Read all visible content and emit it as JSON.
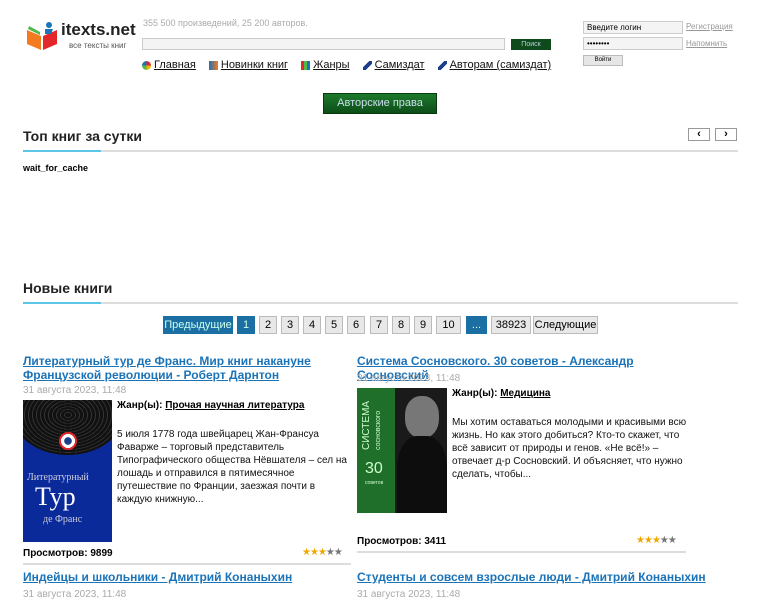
{
  "header": {
    "logo_text": "itexts.net",
    "logo_sub": "все тексты книг",
    "stats": "355 500 произведений, 25 200 авторов.",
    "search_button": "Поиск",
    "search_value": ""
  },
  "login": {
    "login_value": "Введите логин",
    "password_value": "••••••••",
    "register": "Регистрация",
    "remind": "Напомнить",
    "submit": "Войти"
  },
  "nav": [
    {
      "label": "Главная",
      "icon": "home-icon"
    },
    {
      "label": "Новинки книг",
      "icon": "new-books-icon"
    },
    {
      "label": "Жанры",
      "icon": "genres-icon"
    },
    {
      "label": "Самиздат",
      "icon": "pen-icon"
    },
    {
      "label": "Авторам (самиздат)",
      "icon": "pen-icon"
    }
  ],
  "copyright_button": "Авторские права",
  "top": {
    "title": "Топ книг за сутки",
    "prev": "‹",
    "next": "›",
    "status": "wait_for_cache"
  },
  "new_books": {
    "title": "Новые книги"
  },
  "pagination": {
    "prev": "Предыдущие",
    "pages": [
      "1",
      "2",
      "3",
      "4",
      "5",
      "6",
      "7",
      "8",
      "9",
      "10"
    ],
    "ellipsis": "...",
    "last": "38923",
    "next": "Следующие",
    "current": "1"
  },
  "books": [
    {
      "title": "Литературный тур де Франс. Мир книг накануне Французской революции - Роберт Дарнтон",
      "date": "31 августа 2023, 11:48",
      "genre_label": "Жанр(ы):",
      "genre": "Прочая научная литература",
      "description": "5 июля 1778 года швейцарец Жан-Франсуа Фаварже – торговый представитель Типографического общества Нёвшателя – сел на лошадь и отправился в пятимесячное путешествие по Франции, заезжая почти в каждую книжную...",
      "views": "Просмотров: 9899",
      "rating": 3,
      "cover": {
        "l1": "Литературный",
        "l2": "Тур",
        "l3": "де Франс"
      }
    },
    {
      "title": "Система Сосновского. 30 советов - Александр Сосновский",
      "date": "31 августа 2023, 11:48",
      "genre_label": "Жанр(ы):",
      "genre": "Медицина",
      "description": "Мы хотим оставаться молодыми и красивыми всю жизнь. Но как этого добиться? Кто-то скажет, что всё зависит от природы и генов. «Не всё!» – отвечает д-р Сосновский. И объясняет, что нужно сделать, чтобы...",
      "views": "Просмотров: 3411",
      "rating": 3,
      "cover": {
        "l1": "СИСТЕМА",
        "l2": "сосновского",
        "l3": "30",
        "l4": "советов"
      }
    },
    {
      "title": "Индейцы и школьники - Дмитрий Конаныхин",
      "date": "31 августа 2023, 11:48"
    },
    {
      "title": "Студенты и совсем взрослые люди - Дмитрий Конаныхин",
      "date": "31 августа 2023, 11:48"
    }
  ],
  "colors": {
    "accent": "#1b73b8",
    "button_green": "#0f5a1c",
    "pager_active": "#1b6fa3",
    "underline": "#5bc6e8"
  }
}
